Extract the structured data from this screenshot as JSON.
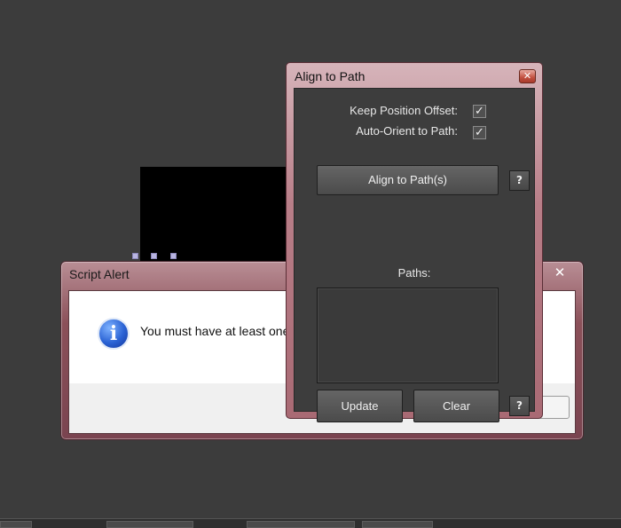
{
  "background": {
    "color": "#3c3c3c"
  },
  "alert": {
    "title": "Script Alert",
    "close_glyph": "✕",
    "icon": "info-icon",
    "icon_glyph": "i",
    "message": "You must have at least one"
  },
  "panel": {
    "title": "Align to Path",
    "close_glyph": "✕",
    "options": [
      {
        "label": "Keep Position Offset:",
        "checked": true
      },
      {
        "label": "Auto-Orient to Path:",
        "checked": true
      }
    ],
    "align_button": "Align to Path(s)",
    "help_glyph": "?",
    "paths_label": "Paths:",
    "update_button": "Update",
    "clear_button": "Clear"
  },
  "colors": {
    "panel_bg": "#3d3d3d",
    "accent_frame": "#a96a74",
    "info_blue": "#2a62d4"
  }
}
